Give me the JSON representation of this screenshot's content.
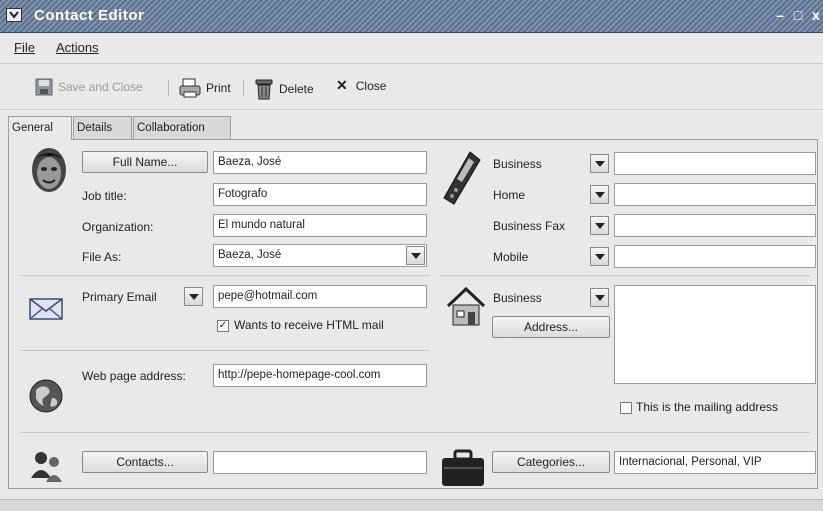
{
  "window": {
    "title": "Contact Editor",
    "minimize": "–",
    "maximize": "□",
    "close": "x"
  },
  "menu": {
    "file": "File",
    "actions": "Actions"
  },
  "toolbar": {
    "save_close": "Save and Close",
    "print": "Print",
    "delete": "Delete",
    "close": "Close"
  },
  "tabs": [
    "General",
    "Details",
    "Collaboration"
  ],
  "name": {
    "full_name_button": "Full Name...",
    "full_name": "Baeza, José",
    "job_title_label": "Job title:",
    "job_title": "Fotografo",
    "organization_label": "Organization:",
    "organization": "El mundo natural",
    "file_as_label": "File As:",
    "file_as": "Baeza, José"
  },
  "phones": [
    {
      "label": "Business",
      "value": ""
    },
    {
      "label": "Home",
      "value": ""
    },
    {
      "label": "Business Fax",
      "value": ""
    },
    {
      "label": "Mobile",
      "value": ""
    }
  ],
  "email": {
    "label": "Primary Email",
    "value": "pepe@hotmail.com",
    "html_mail_label": "Wants to receive HTML mail",
    "html_mail_checked": true,
    "check_mark": "✓"
  },
  "web": {
    "label": "Web page address:",
    "value": "http://pepe-homepage-cool.com"
  },
  "address": {
    "type": "Business",
    "button": "Address...",
    "text": "",
    "mailing_label": "This is the mailing address",
    "mailing_checked": false
  },
  "contacts": {
    "button": "Contacts...",
    "value": ""
  },
  "categories": {
    "button": "Categories...",
    "value": "Internacional, Personal, VIP"
  },
  "icons": [
    "window-menu-icon",
    "save-icon",
    "print-icon",
    "delete-icon",
    "close-x-icon",
    "contact-face-icon",
    "phone-icon",
    "email-envelope-icon",
    "house-icon",
    "globe-icon",
    "contacts-people-icon",
    "briefcase-icon"
  ]
}
